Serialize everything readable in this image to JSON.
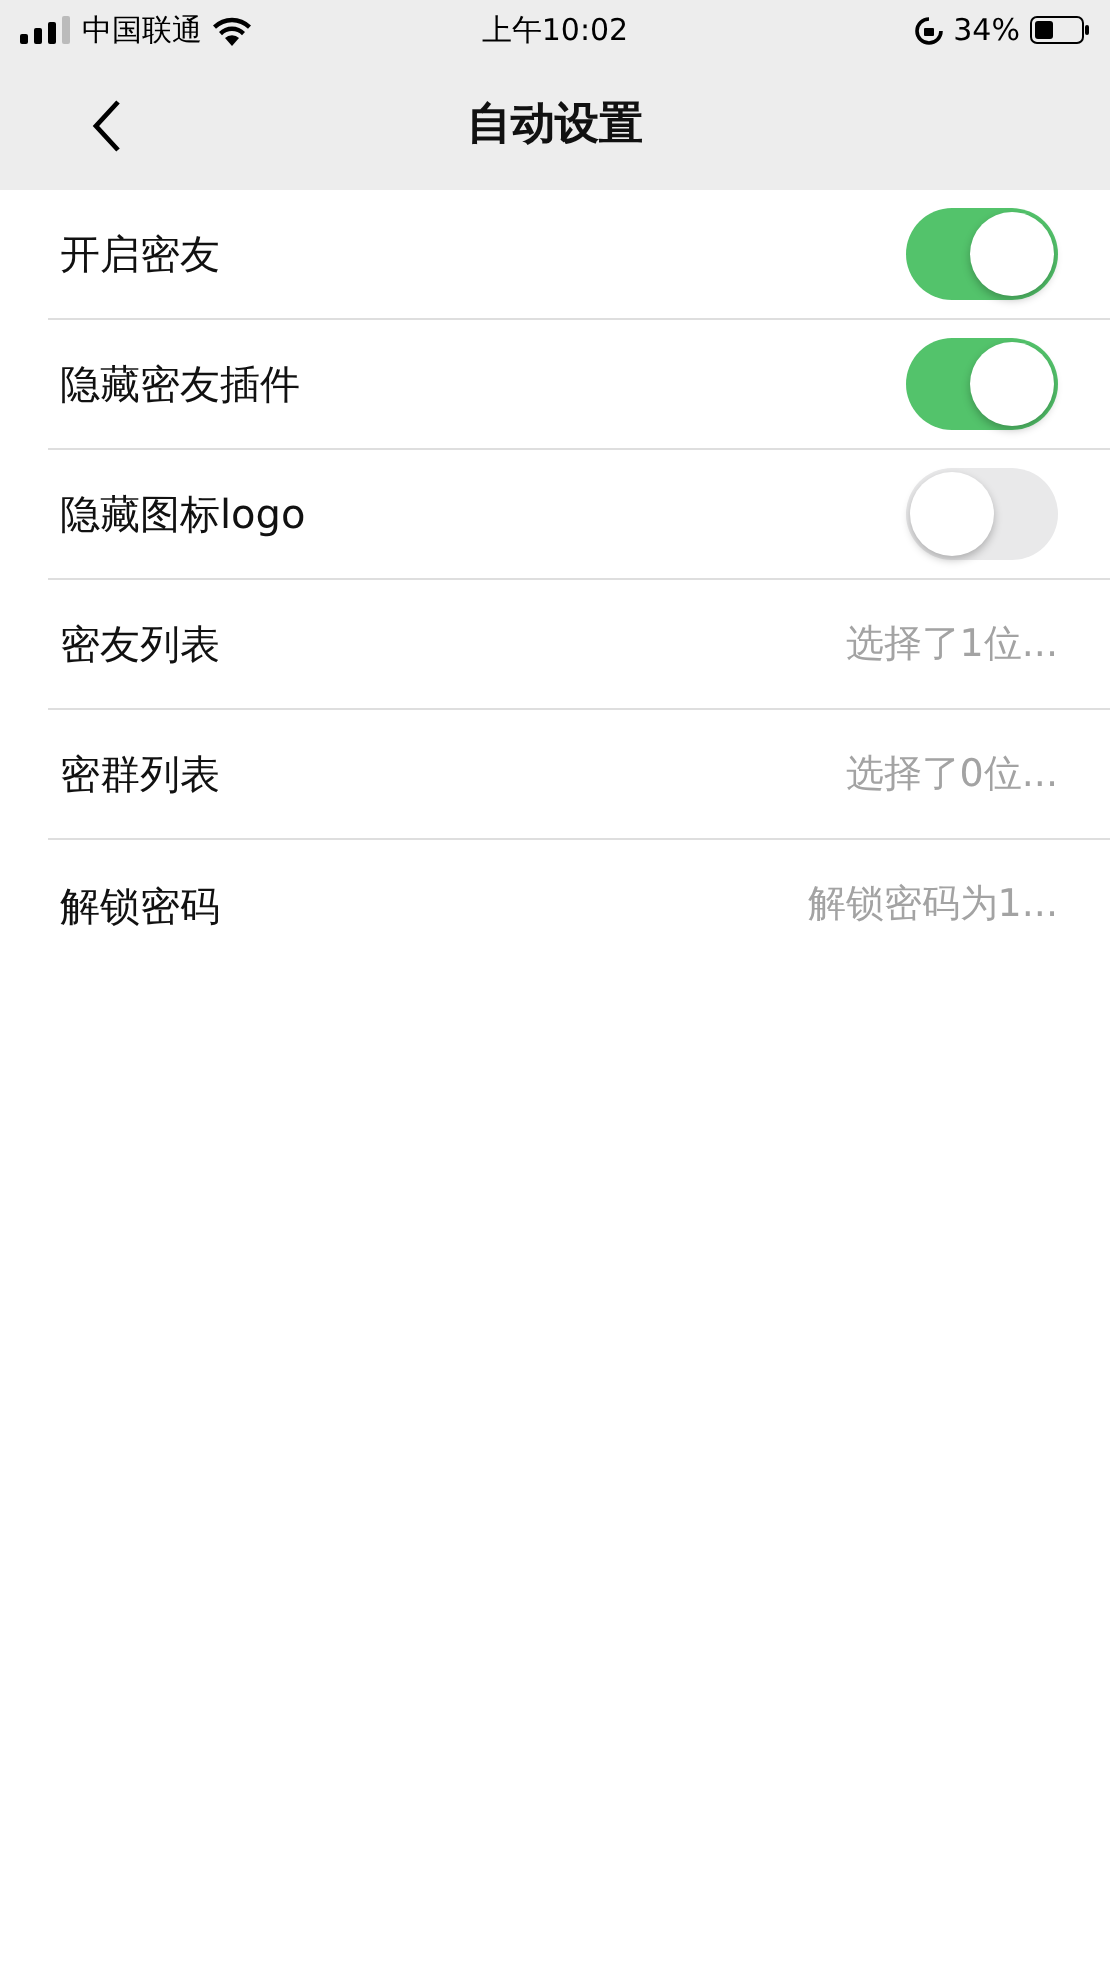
{
  "status_bar": {
    "carrier": "中国联通",
    "time": "上午10:02",
    "battery": "34%"
  },
  "nav": {
    "title": "自动设置"
  },
  "rows": [
    {
      "kind": "toggle",
      "label": "开启密友",
      "on": true
    },
    {
      "kind": "toggle",
      "label": "隐藏密友插件",
      "on": true
    },
    {
      "kind": "toggle",
      "label": "隐藏图标logo",
      "on": false
    },
    {
      "kind": "value",
      "label": "密友列表",
      "value": "选择了1位..."
    },
    {
      "kind": "value",
      "label": "密群列表",
      "value": "选择了0位..."
    },
    {
      "kind": "value",
      "label": "解锁密码",
      "value": "解锁密码为1..."
    }
  ]
}
